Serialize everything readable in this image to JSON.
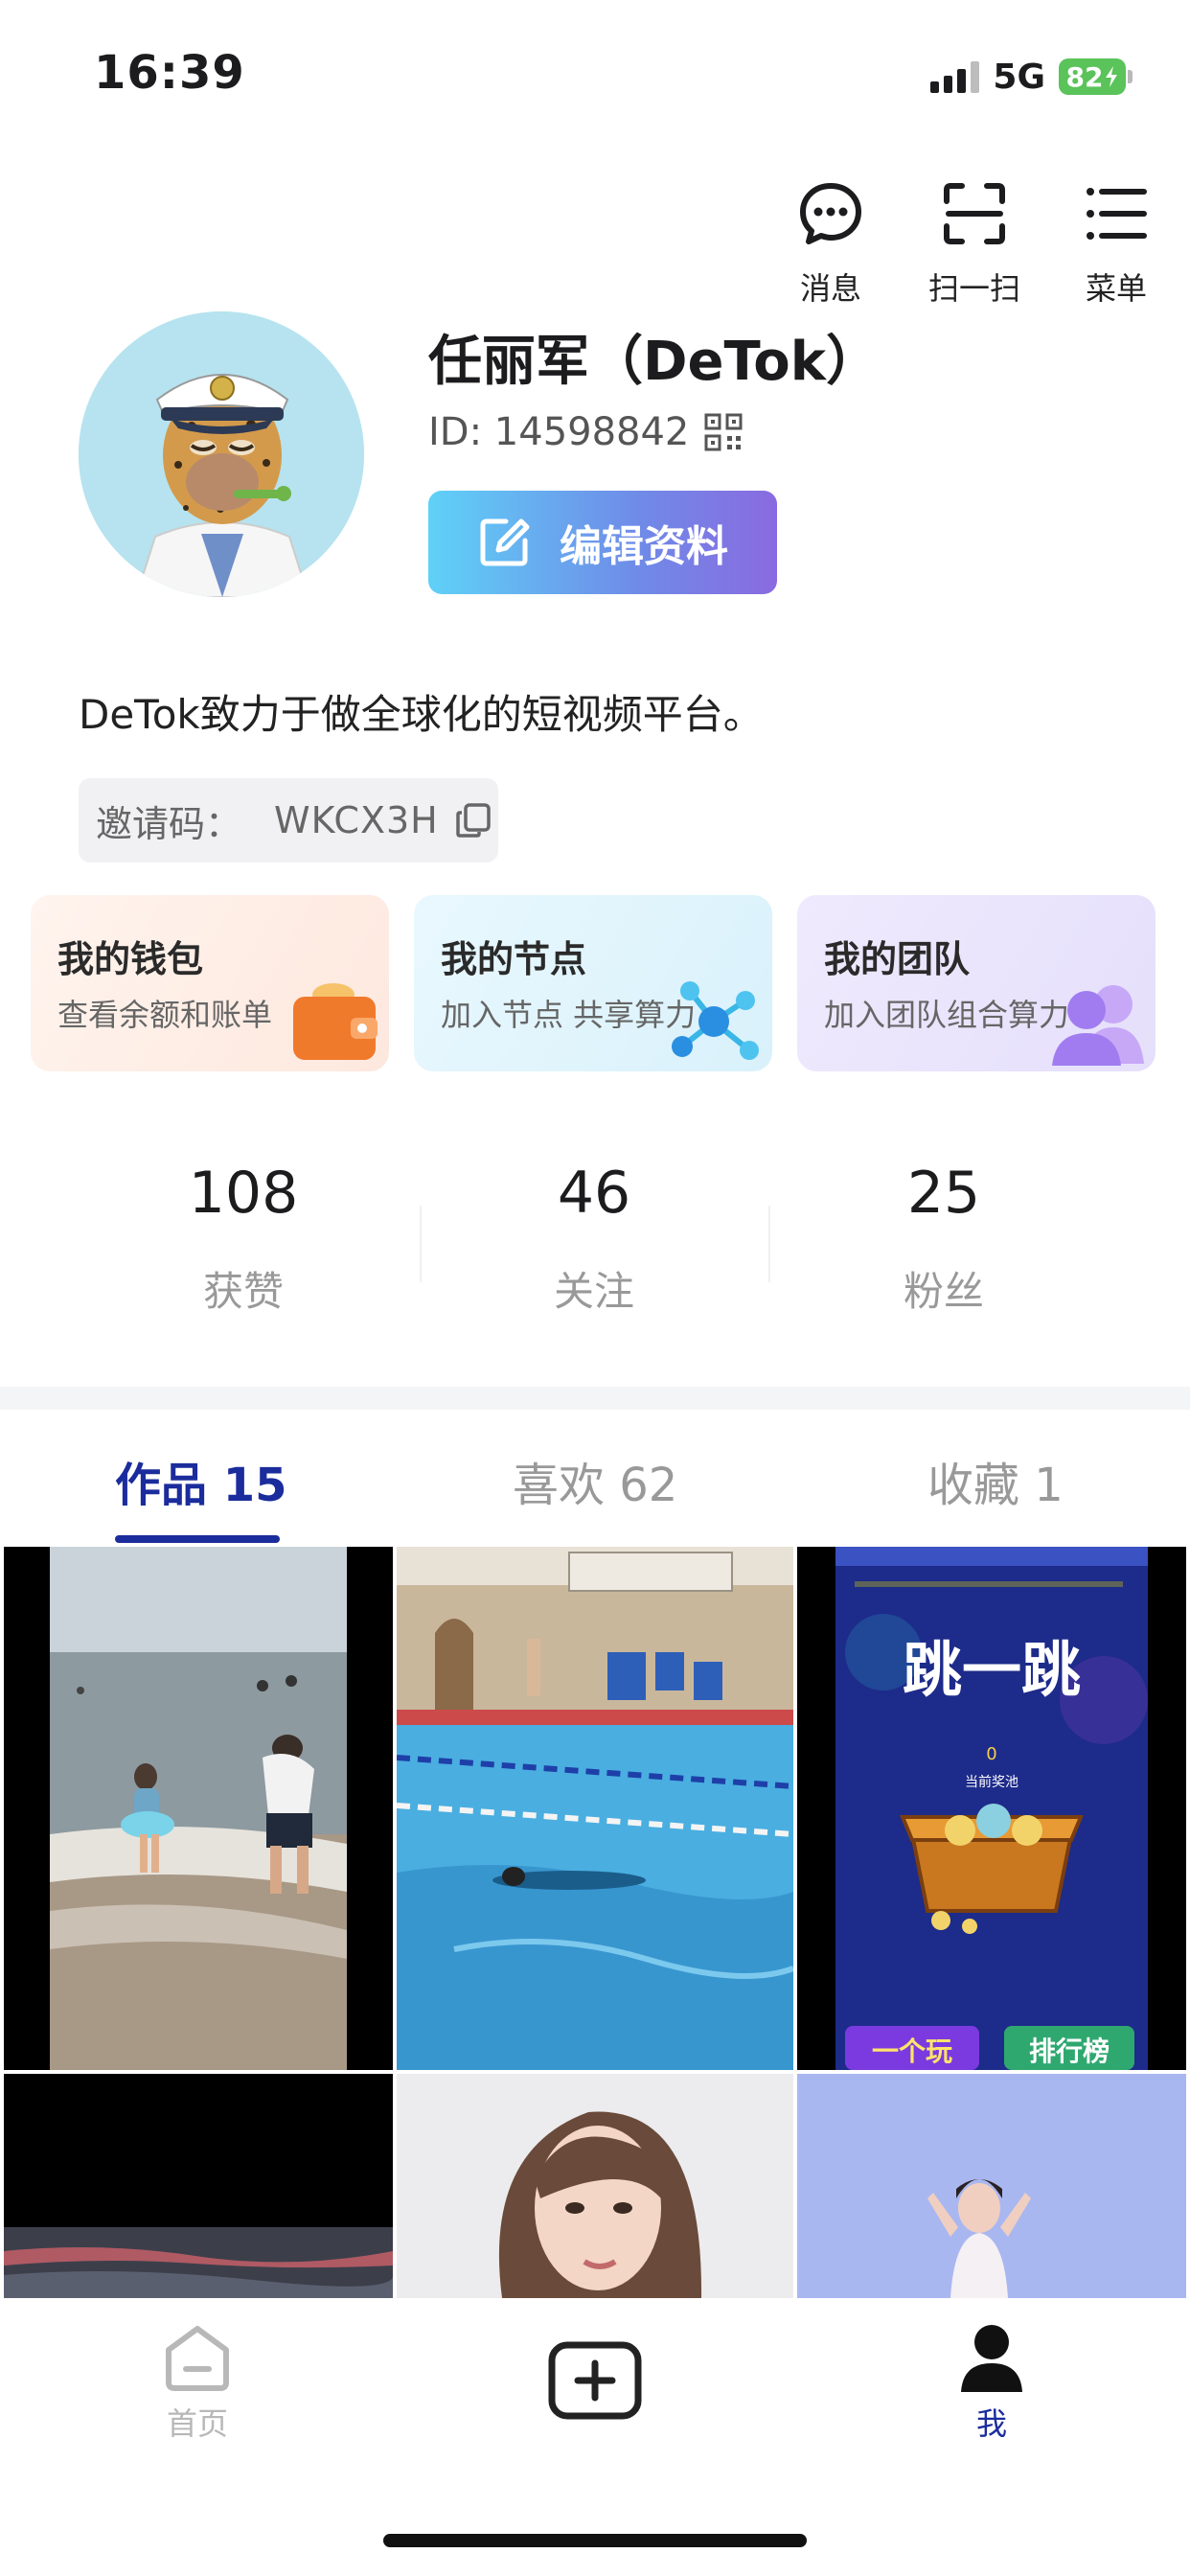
{
  "status_bar": {
    "time": "16:39",
    "network": "5G",
    "battery": "82"
  },
  "top_actions": [
    {
      "label": "消息",
      "icon": "chat-bubble-icon"
    },
    {
      "label": "扫一扫",
      "icon": "scan-icon"
    },
    {
      "label": "菜单",
      "icon": "menu-icon"
    }
  ],
  "profile": {
    "name": "任丽军（DeTok）",
    "id": "ID: 14598842",
    "edit_button": "编辑资料",
    "bio": "DeTok致力于做全球化的短视频平台。",
    "invite_label": "邀请码：",
    "invite_code": "WKCX3H"
  },
  "cards": [
    {
      "title": "我的钱包",
      "subtitle": "查看余额和账单",
      "icon": "wallet-icon",
      "bg": "#fff1ea"
    },
    {
      "title": "我的节点",
      "subtitle": "加入节点 共享算力",
      "icon": "network-node-icon",
      "bg": "#e5f6fd"
    },
    {
      "title": "我的团队",
      "subtitle": "加入团队组合算力",
      "icon": "team-icon",
      "bg": "#ede9fc"
    }
  ],
  "stats": [
    {
      "value": "108",
      "label": "获赞"
    },
    {
      "value": "46",
      "label": "关注"
    },
    {
      "value": "25",
      "label": "粉丝"
    }
  ],
  "tabs": [
    {
      "label": "作品 15",
      "active": true
    },
    {
      "label": "喜欢 62",
      "active": false
    },
    {
      "label": "收藏 1",
      "active": false
    }
  ],
  "grid_tiles": [
    {
      "name": "video-thumb-beach"
    },
    {
      "name": "video-thumb-swimming-pool"
    },
    {
      "name": "video-thumb-jump-game",
      "title": "跳一跳",
      "caption": "当前奖池",
      "counter": "0",
      "left_banner": "一个玩",
      "right_banner": "排行榜"
    },
    {
      "name": "video-thumb-dark-sky"
    },
    {
      "name": "video-thumb-portrait-woman"
    },
    {
      "name": "video-thumb-dancer"
    }
  ],
  "bottom_nav": [
    {
      "label": "首页",
      "icon": "home-icon",
      "active": false
    },
    {
      "label": "",
      "icon": "add-post-icon",
      "active": false
    },
    {
      "label": "我",
      "icon": "person-icon",
      "active": true
    }
  ],
  "colors": {
    "accent": "#1b2c9c",
    "battery_green": "#5ac35a"
  }
}
